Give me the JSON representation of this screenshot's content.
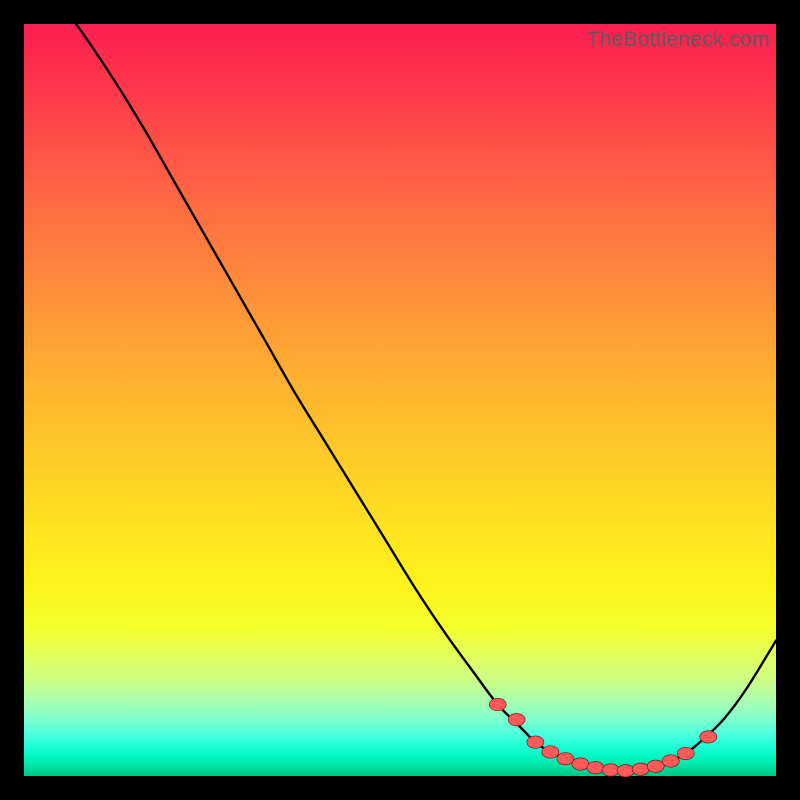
{
  "watermark": "TheBottleneck.com",
  "colors": {
    "curve": "#000000",
    "marker_fill": "#ff5a5a",
    "marker_stroke": "#6b0b0b"
  },
  "chart_data": {
    "type": "line",
    "title": "",
    "xlabel": "",
    "ylabel": "",
    "xlim": [
      0,
      100
    ],
    "ylim": [
      0,
      100
    ],
    "x": [
      0,
      4,
      8,
      12,
      16,
      20,
      24,
      28,
      32,
      36,
      40,
      44,
      48,
      52,
      56,
      60,
      63,
      66,
      68,
      70,
      72,
      74,
      76,
      78,
      80,
      82,
      84,
      86,
      88,
      90,
      93,
      96,
      100
    ],
    "y": [
      110,
      104,
      98.5,
      92.5,
      86,
      79,
      72,
      65,
      58,
      51,
      44.5,
      38,
      31.5,
      25,
      19,
      13.5,
      9.5,
      6.5,
      4.5,
      3.2,
      2.3,
      1.6,
      1.1,
      0.8,
      0.7,
      0.9,
      1.3,
      2.0,
      3.0,
      4.6,
      7.5,
      11.5,
      18
    ],
    "markers": {
      "x": [
        63,
        65.5,
        68,
        70,
        72,
        74,
        76,
        78,
        80,
        82,
        84,
        86,
        88,
        91
      ],
      "y": [
        9.5,
        7.5,
        4.5,
        3.2,
        2.3,
        1.6,
        1.1,
        0.8,
        0.7,
        0.9,
        1.3,
        2.0,
        3.0,
        5.2
      ]
    }
  }
}
